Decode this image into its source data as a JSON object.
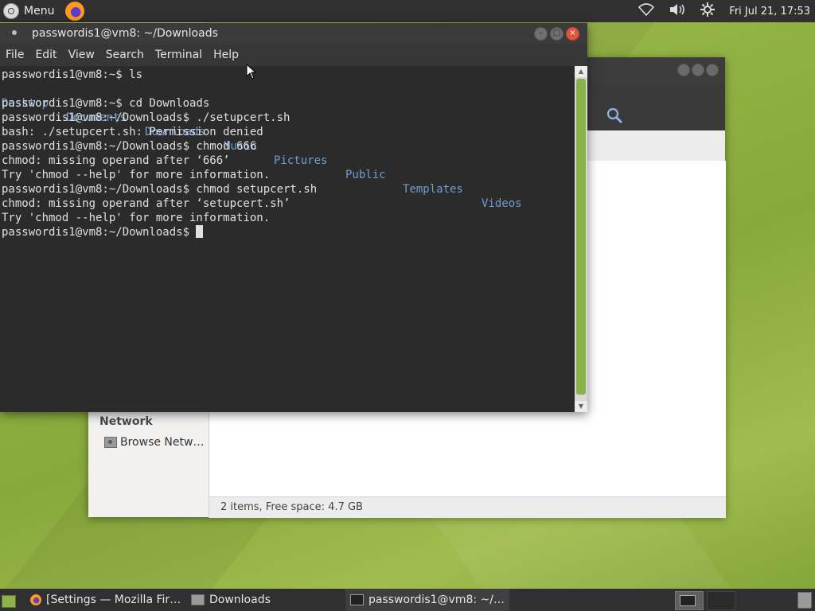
{
  "top_panel": {
    "menu_label": "Menu",
    "clock": "Fri Jul 21, 17:53",
    "icons": [
      "menu-icon",
      "firefox-icon",
      "network-icon",
      "volume-icon",
      "settings-icon"
    ]
  },
  "terminal": {
    "title": "passwordis1@vm8: ~/Downloads",
    "menu": [
      "File",
      "Edit",
      "View",
      "Search",
      "Terminal",
      "Help"
    ],
    "lines": [
      "passwordis1@vm8:~$ ls",
      "",
      "passwordis1@vm8:~$ cd Downloads",
      "passwordis1@vm8:~/Downloads$ ./setupcert.sh",
      "bash: ./setupcert.sh: Permission denied",
      "passwordis1@vm8:~/Downloads$ chmod 666",
      "chmod: missing operand after ‘666’",
      "Try 'chmod --help' for more information.",
      "passwordis1@vm8:~/Downloads$ chmod setupcert.sh",
      "chmod: missing operand after ‘setupcert.sh’",
      "Try 'chmod --help' for more information.",
      "passwordis1@vm8:~/Downloads$ "
    ],
    "ls_output": [
      "Desktop",
      "Documents",
      "Downloads",
      "Music",
      "Pictures",
      "Public",
      "Templates",
      "Videos"
    ],
    "colors": {
      "background": "#2b2b2b",
      "text": "#e0e0e0",
      "directory": "#6f9ecf",
      "scroll_thumb": "#8ab24a",
      "close": "#e0553b"
    }
  },
  "file_manager": {
    "sidebar_heading": "Network",
    "sidebar_item": "Browse Netw…",
    "status": "2 items, Free space: 4.7 GB"
  },
  "taskbar": {
    "tasks": [
      {
        "label": "[Settings — Mozilla Fir…",
        "icon": "firefox-icon"
      },
      {
        "label": "Downloads",
        "icon": "folder-icon"
      },
      {
        "label": "passwordis1@vm8: ~/…",
        "icon": "terminal-icon"
      }
    ]
  }
}
